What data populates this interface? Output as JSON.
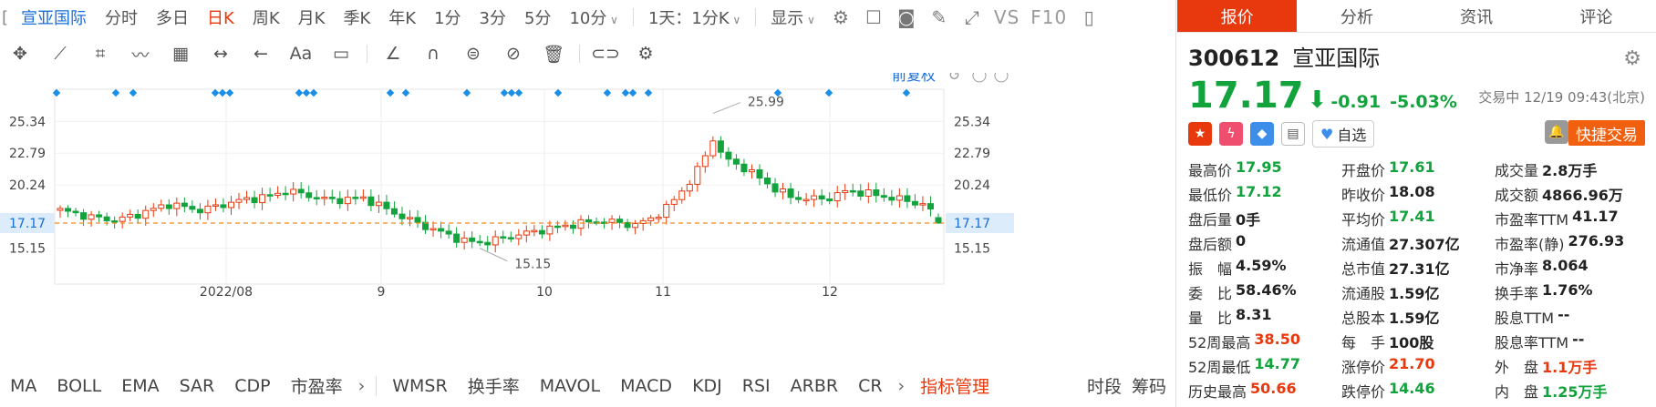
{
  "topbar": {
    "stock_name": "宣亚国际",
    "periods": [
      "分时",
      "多日",
      "日K",
      "周K",
      "月K",
      "季K",
      "年K",
      "1分",
      "3分",
      "5分",
      "10分"
    ],
    "active_period": "日K",
    "interval_select": "1天：1分K",
    "display_label": "显示",
    "vs_label": "VS",
    "f10_label": "F10"
  },
  "chart": {
    "adjust_label": "前复权",
    "y_ticks": [
      "25.34",
      "22.79",
      "20.24",
      "17.17",
      "15.15"
    ],
    "x_ticks": [
      "2022/08",
      "9",
      "10",
      "11",
      "12"
    ],
    "high_label": "25.99",
    "low_label": "15.15",
    "current_price_label": "17.17",
    "colors": {
      "up": "#e8380d",
      "down": "#12a33d",
      "marker": "#1a8fe8",
      "price_line": "#f08a24"
    }
  },
  "chart_data": {
    "type": "candlestick",
    "yticks": [
      25.34,
      22.79,
      20.24,
      17.17,
      15.15
    ],
    "current_price": 17.17,
    "max_high": 25.99,
    "min_low": 15.15
  },
  "bottombar": {
    "indicators": [
      "MA",
      "BOLL",
      "EMA",
      "SAR",
      "CDP",
      "市盈率"
    ],
    "indicators2": [
      "WMSR",
      "换手率",
      "MAVOL",
      "MACD",
      "KDJ",
      "RSI",
      "ARBR",
      "CR"
    ],
    "manage_label": "指标管理",
    "right_labels": [
      "时段",
      "筹码"
    ]
  },
  "quote": {
    "tabs": [
      "报价",
      "分析",
      "资讯",
      "评论"
    ],
    "code": "300612",
    "name": "宣亚国际",
    "price": "17.17",
    "change": "-0.91",
    "change_pct": "-5.03%",
    "status": "交易中 12/19 09:43(北京)",
    "watch_label": "自选",
    "fast_trade_label": "快捷交易",
    "rows": [
      [
        {
          "label": "最高价",
          "value": "17.95",
          "color": "green"
        },
        {
          "label": "开盘价",
          "value": "17.61",
          "color": "green"
        },
        {
          "label": "成交量",
          "value": "2.8万手",
          "color": ""
        }
      ],
      [
        {
          "label": "最低价",
          "value": "17.12",
          "color": "green"
        },
        {
          "label": "昨收价",
          "value": "18.08",
          "color": ""
        },
        {
          "label": "成交额",
          "value": "4866.96万",
          "color": ""
        }
      ],
      [
        {
          "label": "盘后量",
          "value": "0手",
          "color": ""
        },
        {
          "label": "平均价",
          "value": "17.41",
          "color": "green"
        },
        {
          "label": "市盈率TTM",
          "value": "41.17",
          "color": ""
        }
      ],
      [
        {
          "label": "盘后额",
          "value": "0",
          "color": ""
        },
        {
          "label": "流通值",
          "value": "27.307亿",
          "color": ""
        },
        {
          "label": "市盈率(静)",
          "value": "276.93",
          "color": ""
        }
      ],
      [
        {
          "label": "振　幅",
          "value": "4.59%",
          "color": ""
        },
        {
          "label": "总市值",
          "value": "27.31亿",
          "color": ""
        },
        {
          "label": "市净率",
          "value": "8.064",
          "color": ""
        }
      ],
      [
        {
          "label": "委　比",
          "value": "58.46%",
          "color": ""
        },
        {
          "label": "流通股",
          "value": "1.59亿",
          "color": ""
        },
        {
          "label": "换手率",
          "value": "1.76%",
          "color": ""
        }
      ],
      [
        {
          "label": "量　比",
          "value": "8.31",
          "color": ""
        },
        {
          "label": "总股本",
          "value": "1.59亿",
          "color": ""
        },
        {
          "label": "股息TTM",
          "value": "--",
          "color": ""
        }
      ],
      [
        {
          "label": "52周最高",
          "value": "38.50",
          "color": "red"
        },
        {
          "label": "每　手",
          "value": "100股",
          "color": ""
        },
        {
          "label": "股息率TTM",
          "value": "--",
          "color": ""
        }
      ],
      [
        {
          "label": "52周最低",
          "value": "14.77",
          "color": "green"
        },
        {
          "label": "涨停价",
          "value": "21.70",
          "color": "red"
        },
        {
          "label": "外　盘",
          "value": "1.1万手",
          "color": "red"
        }
      ],
      [
        {
          "label": "历史最高",
          "value": "50.66",
          "color": "red"
        },
        {
          "label": "跌停价",
          "value": "14.46",
          "color": "green"
        },
        {
          "label": "内　盘",
          "value": "1.25万手",
          "color": "green"
        }
      ]
    ]
  }
}
